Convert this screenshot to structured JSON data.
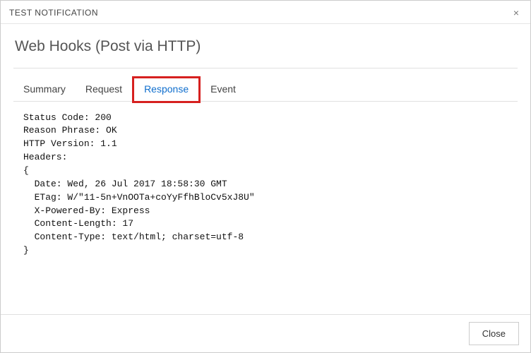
{
  "titlebar": {
    "title": "TEST NOTIFICATION",
    "close_glyph": "×"
  },
  "page": {
    "title": "Web Hooks (Post via HTTP)"
  },
  "tabs": [
    {
      "label": "Summary"
    },
    {
      "label": "Request"
    },
    {
      "label": "Response"
    },
    {
      "label": "Event"
    }
  ],
  "active_tab_index": 2,
  "highlighted_tab_index": 2,
  "response_text": "Status Code: 200\nReason Phrase: OK\nHTTP Version: 1.1\nHeaders:\n{\n  Date: Wed, 26 Jul 2017 18:58:30 GMT\n  ETag: W/\"11-5n+VnOOTa+coYyFfhBloCv5xJ8U\"\n  X-Powered-By: Express\n  Content-Length: 17\n  Content-Type: text/html; charset=utf-8\n}",
  "footer": {
    "close_label": "Close"
  }
}
